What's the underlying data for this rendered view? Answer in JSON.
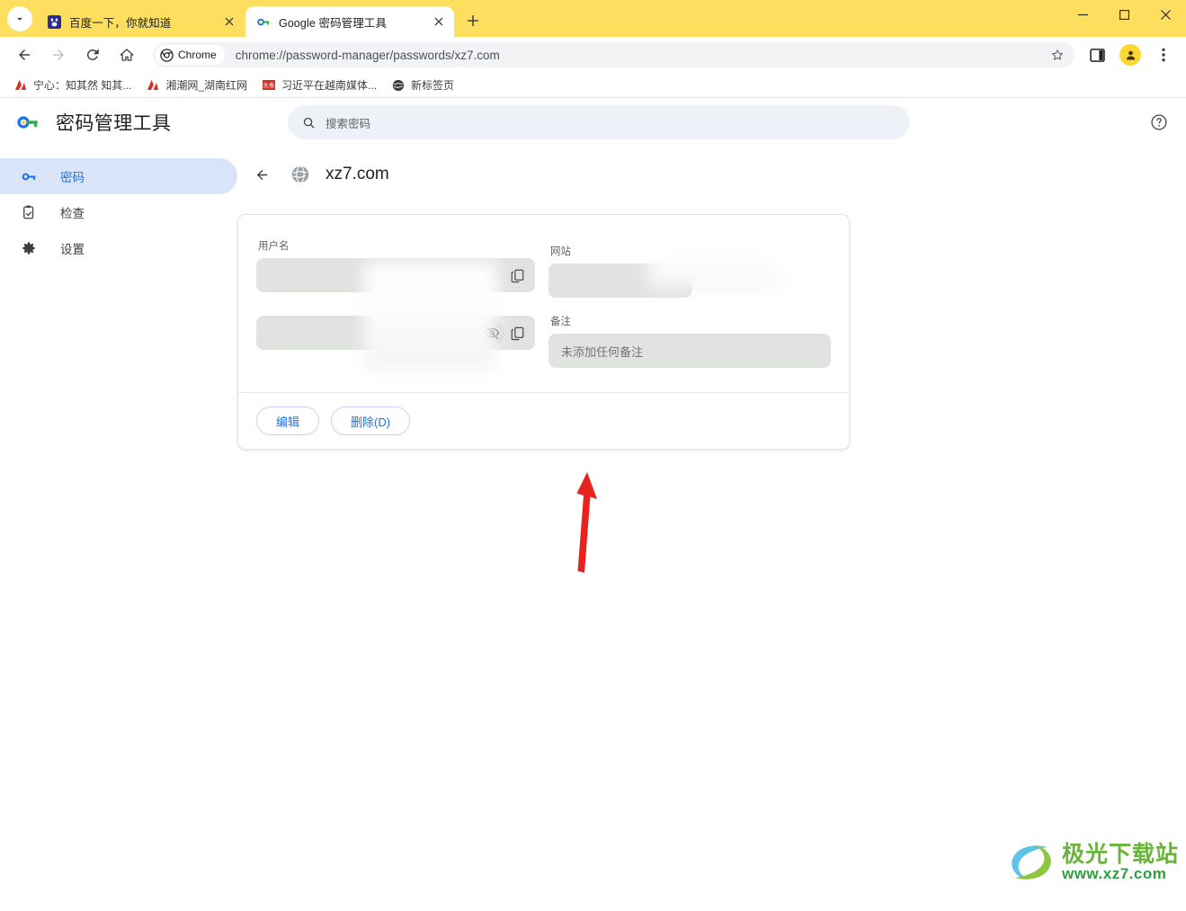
{
  "window": {
    "minimize_label": "minimize",
    "maximize_label": "maximize",
    "close_label": "close"
  },
  "tabstrip": {
    "tab_search_icon": "chevron-down-icon",
    "new_tab_label": "+",
    "tabs": [
      {
        "title": "百度一下，你就知道",
        "favicon": "baidu-paw-icon",
        "active": false
      },
      {
        "title": "Google 密码管理工具",
        "favicon": "google-password-key-icon",
        "active": true
      }
    ]
  },
  "toolbar": {
    "back_icon": "back-arrow-icon",
    "forward_icon": "forward-arrow-icon",
    "reload_icon": "reload-icon",
    "home_icon": "home-icon",
    "chrome_chip_label": "Chrome",
    "url": "chrome://password-manager/passwords/xz7.com",
    "bookmark_icon": "star-icon",
    "sidepanel_icon": "side-panel-icon",
    "profile_icon": "profile-avatar-icon",
    "menu_icon": "three-dot-menu-icon"
  },
  "bookmarks": [
    {
      "label": "宁心：知其然 知其...",
      "icon": "red-site-icon"
    },
    {
      "label": "湘潮网_湖南红网",
      "icon": "red-site-icon"
    },
    {
      "label": "习近平在越南媒体...",
      "icon": "toutiao-icon"
    },
    {
      "label": "新标签页",
      "icon": "globe-icon"
    }
  ],
  "password_manager": {
    "logo_icon": "google-password-key-icon",
    "title": "密码管理工具",
    "search": {
      "placeholder": "搜索密码",
      "value": "",
      "icon": "search-icon"
    },
    "help_icon": "help-circle-icon",
    "sidebar": {
      "items": [
        {
          "label": "密码",
          "icon": "key-icon",
          "active": true
        },
        {
          "label": "检查",
          "icon": "clipboard-check-icon",
          "active": false
        },
        {
          "label": "设置",
          "icon": "gear-icon",
          "active": false
        }
      ]
    },
    "detail": {
      "back_icon": "back-arrow-icon",
      "site_favicon": "globe-icon",
      "site_name": "xz7.com",
      "username": {
        "label": "用户名",
        "value": "",
        "copy_icon": "copy-icon"
      },
      "password": {
        "label": "",
        "value": "",
        "show_icon": "eye-off-icon",
        "copy_icon": "copy-icon"
      },
      "website": {
        "label": "网站",
        "value": ""
      },
      "note": {
        "label": "备注",
        "placeholder": "未添加任何备注"
      },
      "actions": {
        "edit_label": "编辑",
        "delete_label": "删除(D)"
      }
    }
  },
  "annotation": {
    "arrow_color": "#e8231f",
    "points_to": "eye-off-icon"
  },
  "watermark": {
    "line1": "极光下载站",
    "line2": "www.xz7.com"
  },
  "colors": {
    "titlebar_yellow": "#fdde5e",
    "accent_blue": "#1a73e8",
    "sidebar_active_bg": "#d9e4f8",
    "field_bg": "#e1e3e1",
    "search_bg": "#eef1f7"
  }
}
